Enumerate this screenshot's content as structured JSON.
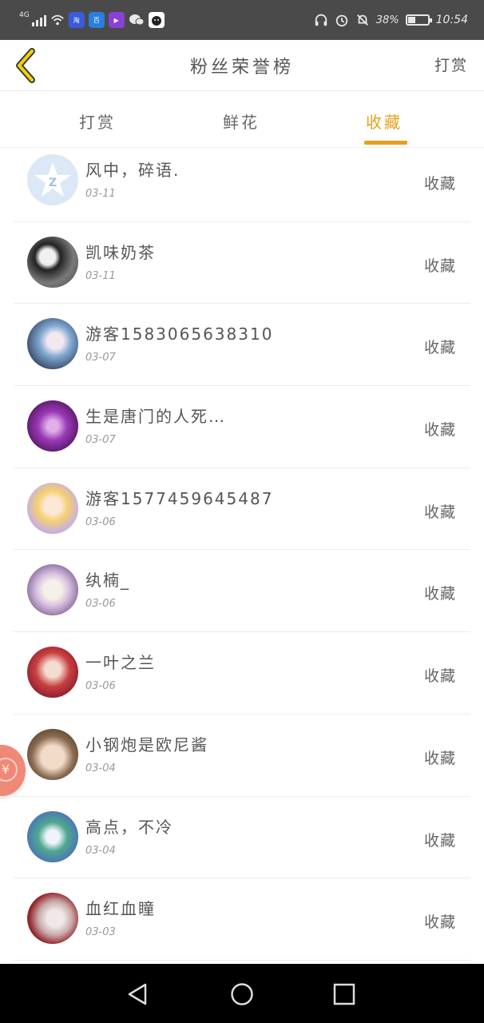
{
  "status_bar": {
    "network": "4G",
    "time": "10:54",
    "battery": "38%",
    "battery_level": 0.38,
    "app_icons": [
      "taobao-icon",
      "baidu-icon",
      "video-icon",
      "wechat-icon",
      "cat-icon"
    ]
  },
  "header": {
    "title": "粉丝荣誉榜",
    "right_link": "打赏"
  },
  "tabs": [
    {
      "label": "打赏",
      "active": false
    },
    {
      "label": "鲜花",
      "active": false
    },
    {
      "label": "收藏",
      "active": true
    }
  ],
  "list": [
    {
      "name": "风中，碎语.",
      "date": "03-11",
      "action": "收藏"
    },
    {
      "name": "凯味奶茶",
      "date": "03-11",
      "action": "收藏"
    },
    {
      "name": "游客1583065638310",
      "date": "03-07",
      "action": "收藏"
    },
    {
      "name": "生是唐门的人死…",
      "date": "03-07",
      "action": "收藏"
    },
    {
      "name": "游客1577459645487",
      "date": "03-06",
      "action": "收藏"
    },
    {
      "name": "纨楠_",
      "date": "03-06",
      "action": "收藏"
    },
    {
      "name": "一叶之兰",
      "date": "03-06",
      "action": "收藏"
    },
    {
      "name": "小钢炮是欧尼酱",
      "date": "03-04",
      "action": "收藏"
    },
    {
      "name": "高点，不冷",
      "date": "03-04",
      "action": "收藏"
    },
    {
      "name": "血红血瞳",
      "date": "03-03",
      "action": "收藏"
    }
  ],
  "floating_badge": {
    "symbol": "¥"
  },
  "colors": {
    "accent": "#e6a01c",
    "status_bar_bg": "#4a4a4a",
    "nav_bar_bg": "#000000",
    "divider": "#ececec"
  }
}
